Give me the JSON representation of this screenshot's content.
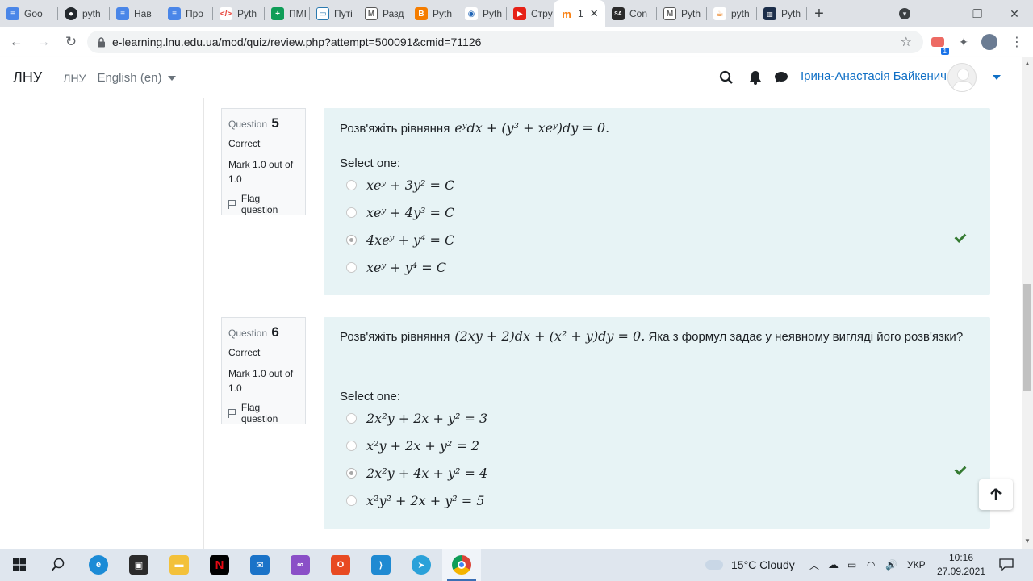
{
  "browser": {
    "tabs": [
      {
        "label": "Goo",
        "icon": "google-docs-icon",
        "color": "#4a86e8"
      },
      {
        "label": "pyth",
        "icon": "github-icon",
        "color": "#24292e"
      },
      {
        "label": "Нав",
        "icon": "google-docs-icon",
        "color": "#4a86e8"
      },
      {
        "label": "Про",
        "icon": "google-docs-icon",
        "color": "#4a86e8"
      },
      {
        "label": "Pyth",
        "icon": "code-icon",
        "color": "#e8453c"
      },
      {
        "label": "ПМІ",
        "icon": "plus-icon",
        "color": "#0f9d58"
      },
      {
        "label": "Путі",
        "icon": "monitor-icon",
        "color": "#2a7ab0"
      },
      {
        "label": "Разд",
        "icon": "moodle-m-icon",
        "color": "#5a5a5a"
      },
      {
        "label": "Pyth",
        "icon": "blogger-icon",
        "color": "#f57d00"
      },
      {
        "label": "Pyth",
        "icon": "circle-icon",
        "color": "#1e63b5"
      },
      {
        "label": "Стру",
        "icon": "youtube-icon",
        "color": "#e62117"
      },
      {
        "label": "1",
        "icon": "moodle-icon",
        "color": "#f98012",
        "active": true
      },
      {
        "label": "Con",
        "icon": "sa-icon",
        "color": "#2b2b2b"
      },
      {
        "label": "Pyth",
        "icon": "moodle-m-icon",
        "color": "#5a5a5a"
      },
      {
        "label": "pyth",
        "icon": "java-icon",
        "color": "#e76f00"
      },
      {
        "label": "Pyth",
        "icon": "book-icon",
        "color": "#1c2e4a"
      }
    ],
    "url": "e-learning.lnu.edu.ua/mod/quiz/review.php?attempt=500091&cmid=71126",
    "ext_badge": "1"
  },
  "header": {
    "brand": "ЛНУ",
    "nav_link": "ЛНУ",
    "language": "English (en)",
    "user_name": "Ірина-Анастасія Байкенич"
  },
  "questions": [
    {
      "label": "Question",
      "number": "5",
      "state": "Correct",
      "grade": "Mark 1.0 out of 1.0",
      "flag": "Flag question",
      "text": "Розв'яжіть рівняння",
      "equation": "eʸdx + (y³ + xeʸ)dy = 0.",
      "select_label": "Select one:",
      "options": [
        {
          "text": "xeʸ + 3y² = C",
          "selected": false
        },
        {
          "text": "xeʸ + 4y³ = C",
          "selected": false
        },
        {
          "text": "4xeʸ + y⁴ = C",
          "selected": true,
          "correct": true
        },
        {
          "text": "xeʸ + y⁴ = C",
          "selected": false
        }
      ]
    },
    {
      "label": "Question",
      "number": "6",
      "state": "Correct",
      "grade": "Mark 1.0 out of 1.0",
      "flag": "Flag question",
      "text": "Розв'яжіть рівняння",
      "equation": "(2xy + 2)dx + (x² + y)dy = 0.",
      "text_after": "Яка з формул задає у неявному вигляді його розв'язки?",
      "select_label": "Select one:",
      "options": [
        {
          "text": "2x²y + 2x + y² = 3",
          "selected": false
        },
        {
          "text": "x²y + 2x + y² = 2",
          "selected": false
        },
        {
          "text": "2x²y + 4x + y² = 4",
          "selected": true,
          "correct": true
        },
        {
          "text": "x²y² + 2x + y² = 5",
          "selected": false
        }
      ]
    }
  ],
  "taskbar": {
    "weather": "15°C  Cloudy",
    "lang": "УКР",
    "time": "10:16",
    "date": "27.09.2021"
  }
}
